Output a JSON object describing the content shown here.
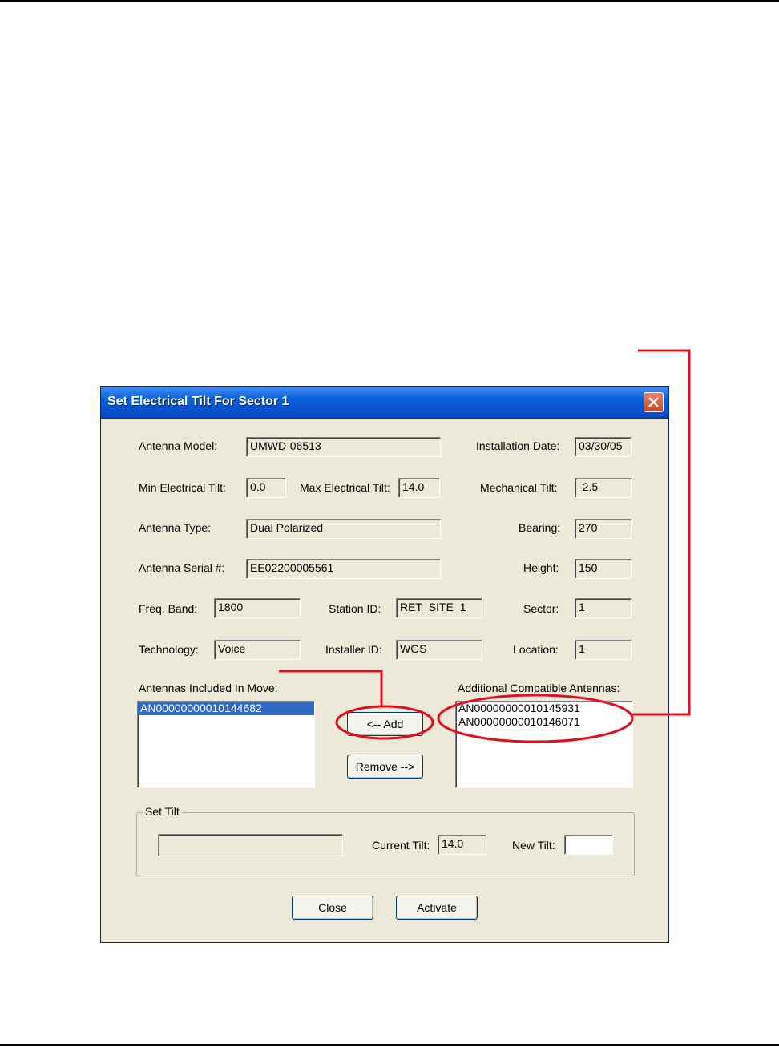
{
  "window": {
    "title": "Set Electrical Tilt For Sector 1"
  },
  "fields": {
    "antenna_model": {
      "label": "Antenna Model:",
      "value": "UMWD-06513"
    },
    "installation_date": {
      "label": "Installation Date:",
      "value": "03/30/05"
    },
    "min_tilt": {
      "label": "Min Electrical Tilt:",
      "value": "0.0"
    },
    "max_tilt": {
      "label": "Max Electrical Tilt:",
      "value": "14.0"
    },
    "mechanical_tilt": {
      "label": "Mechanical Tilt:",
      "value": "-2.5"
    },
    "antenna_type": {
      "label": "Antenna Type:",
      "value": "Dual Polarized"
    },
    "bearing": {
      "label": "Bearing:",
      "value": "270"
    },
    "serial": {
      "label": "Antenna Serial #:",
      "value": "EE02200005561"
    },
    "height": {
      "label": "Height:",
      "value": "150"
    },
    "freq_band": {
      "label": "Freq. Band:",
      "value": "1800"
    },
    "station_id": {
      "label": "Station ID:",
      "value": "RET_SITE_1"
    },
    "sector": {
      "label": "Sector:",
      "value": "1"
    },
    "technology": {
      "label": "Technology:",
      "value": "Voice"
    },
    "installer_id": {
      "label": "Installer ID:",
      "value": "WGS"
    },
    "location": {
      "label": "Location:",
      "value": "1"
    }
  },
  "lists": {
    "included": {
      "label": "Antennas Included In Move:",
      "items": [
        "AN00000000010144682"
      ]
    },
    "compatible": {
      "label": "Additional Compatible Antennas:",
      "items": [
        "AN00000000010145931",
        "AN00000000010146071"
      ]
    }
  },
  "buttons": {
    "add": "<-- Add",
    "remove": "Remove -->",
    "close": "Close",
    "activate": "Activate"
  },
  "set_tilt": {
    "group_label": "Set Tilt",
    "current_label": "Current Tilt:",
    "current_value": "14.0",
    "new_label": "New Tilt:",
    "new_value": ""
  },
  "colors": {
    "annotation": "#e01020",
    "titlebar": "#0a5fd8",
    "selection": "#316ac5"
  }
}
